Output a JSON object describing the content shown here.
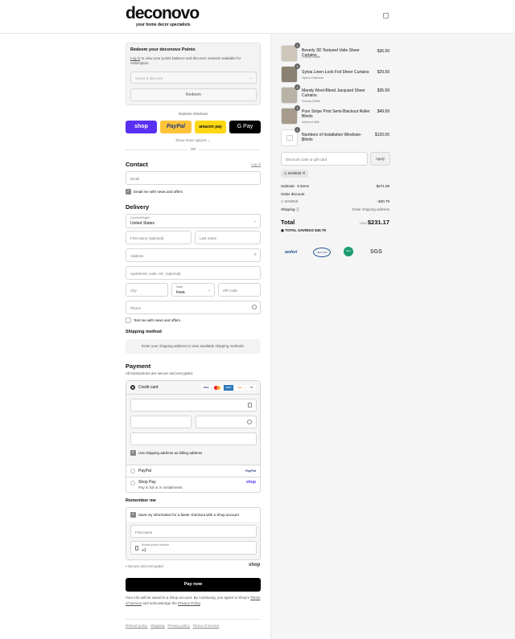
{
  "header": {
    "logo": "deconovo",
    "tagline": "your home decor specialists"
  },
  "points": {
    "title": "Redeem your deconovo Points",
    "login_link": "Log in",
    "desc": " to view your points balance and discover rewards available for redemption.",
    "select_placeholder": "Select a discount",
    "redeem": "Redeem"
  },
  "express": {
    "label": "Express checkout",
    "shop": "shop",
    "paypal": "PayPal",
    "amazon": "amazon pay",
    "gpay": "G Pay",
    "more": "Show more options",
    "or": "OR"
  },
  "contact": {
    "title": "Contact",
    "login": "Log in",
    "email_ph": "Email",
    "news": "Email me with news and offers"
  },
  "delivery": {
    "title": "Delivery",
    "country_label": "Country/Region",
    "country": "United States",
    "first_ph": "First name (optional)",
    "last_ph": "Last name",
    "address_ph": "Address",
    "apt_ph": "Apartment, suite, etc. (optional)",
    "city_ph": "City",
    "state_label": "State",
    "state": "Iowa",
    "zip_ph": "ZIP code",
    "phone_ph": "Phone",
    "text_news": "Text me with news and offers"
  },
  "shipping": {
    "title": "Shipping method",
    "msg": "Enter your shipping address to view available shipping methods."
  },
  "payment": {
    "title": "Payment",
    "subtitle": "All transactions are secure and encrypted.",
    "credit": "Credit card",
    "cards": [
      "VISA",
      "MC",
      "AMEX",
      "DISC",
      "+4"
    ],
    "billing": "Use shipping address as billing address",
    "paypal": "PayPal",
    "paypal_logo": "PayPal",
    "shoppay": "Shop Pay",
    "shoppay_sub": "Pay in full or in installments",
    "shoppay_logo": "shop"
  },
  "remember": {
    "title": "Remember me",
    "save": "Save my information for a faster checkout with a Shop account",
    "first_ph": "First name",
    "mobile_label": "Mobile phone number",
    "mobile": "+1",
    "secure": "Secure and encrypted",
    "shop": "shop"
  },
  "pay": {
    "button": "Pay now",
    "note1": "Your info will be saved to a Shop account. By continuing, you agree to Shop's",
    "tos": "Terms of Service",
    "note2": " and acknowledge the ",
    "privacy": "Privacy Policy",
    "dot": "."
  },
  "footer": [
    "Refund policy",
    "Shipping",
    "Privacy policy",
    "Terms of service"
  ],
  "cart": {
    "items": [
      {
        "qty": "1",
        "name": "Beverly 3D Textured Voile Sheer Curtains",
        "variant": "Snowy White",
        "price": "$36.99"
      },
      {
        "qty": "1",
        "name": "Sylvia Linen-Look Foil Sheer Curtains",
        "variant": "Sylvia Oatmeal",
        "price": "$29.99"
      },
      {
        "qty": "1",
        "name": "Mandy Wool-Blend Jacquard Sheer Curtains",
        "variant": "Snowy White",
        "price": "$35.99"
      },
      {
        "qty": "1",
        "name": "Pure Stripe Print Semi-Blackout Roller Blinds",
        "variant": "Almond Milk",
        "price": "$49.99"
      },
      {
        "qty": "1",
        "name": "Numbers of Installation Windows-Blinds",
        "variant": "1",
        "price": "$120.00"
      }
    ],
    "discount_ph": "Discount code or gift card",
    "apply": "Apply",
    "code": "SAVE15",
    "subtotal_label": "Subtotal · 5 items",
    "subtotal": "$271.96",
    "order_discount": "Order discount",
    "disc_code": "SAVE15",
    "disc_amount": "- $40.79",
    "shipping_label": "Shipping",
    "shipping_val": "Enter shipping address",
    "total_label": "Total",
    "currency": "USD",
    "total": "$231.17",
    "savings_label": "TOTAL SAVINGS",
    "savings": "$40.79",
    "badges": [
      "amfori",
      "OEKO-TEX",
      "Oeko",
      "SGS"
    ]
  }
}
